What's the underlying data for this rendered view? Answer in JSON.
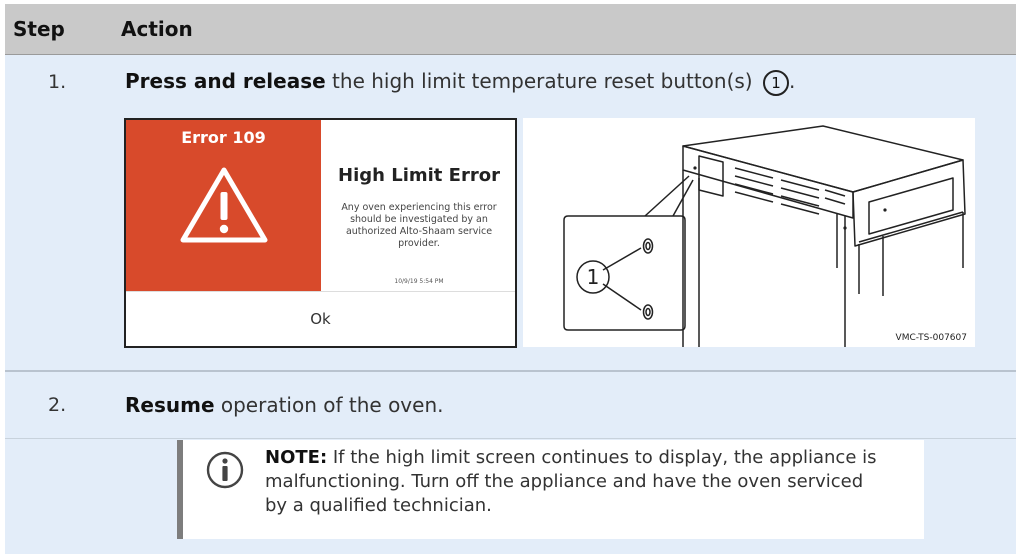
{
  "table": {
    "header_step": "Step",
    "header_action": "Action"
  },
  "step1": {
    "number": "1.",
    "bold": "Press and release",
    "text": " the high limit temperature reset button(s) ",
    "callout": "1",
    "end": "."
  },
  "error_screen": {
    "code": "Error 109",
    "title": "High Limit Error",
    "body": "Any oven experiencing this error should be investigated by an authorized Alto-Shaam service provider.",
    "timestamp": "10/9/19 5:54 PM",
    "button": "Ok",
    "colors": {
      "banner": "#d84a2b"
    }
  },
  "illustration": {
    "callout": "1",
    "label": "VMC-TS-007607"
  },
  "step2": {
    "number": "2.",
    "bold": "Resume",
    "text": " operation of the oven."
  },
  "note": {
    "icon": "info-icon",
    "bold": "NOTE:",
    "text": " If the high limit screen continues to display, the appliance is malfunctioning. Turn off the appliance and have the oven serviced by a qualified technician."
  }
}
